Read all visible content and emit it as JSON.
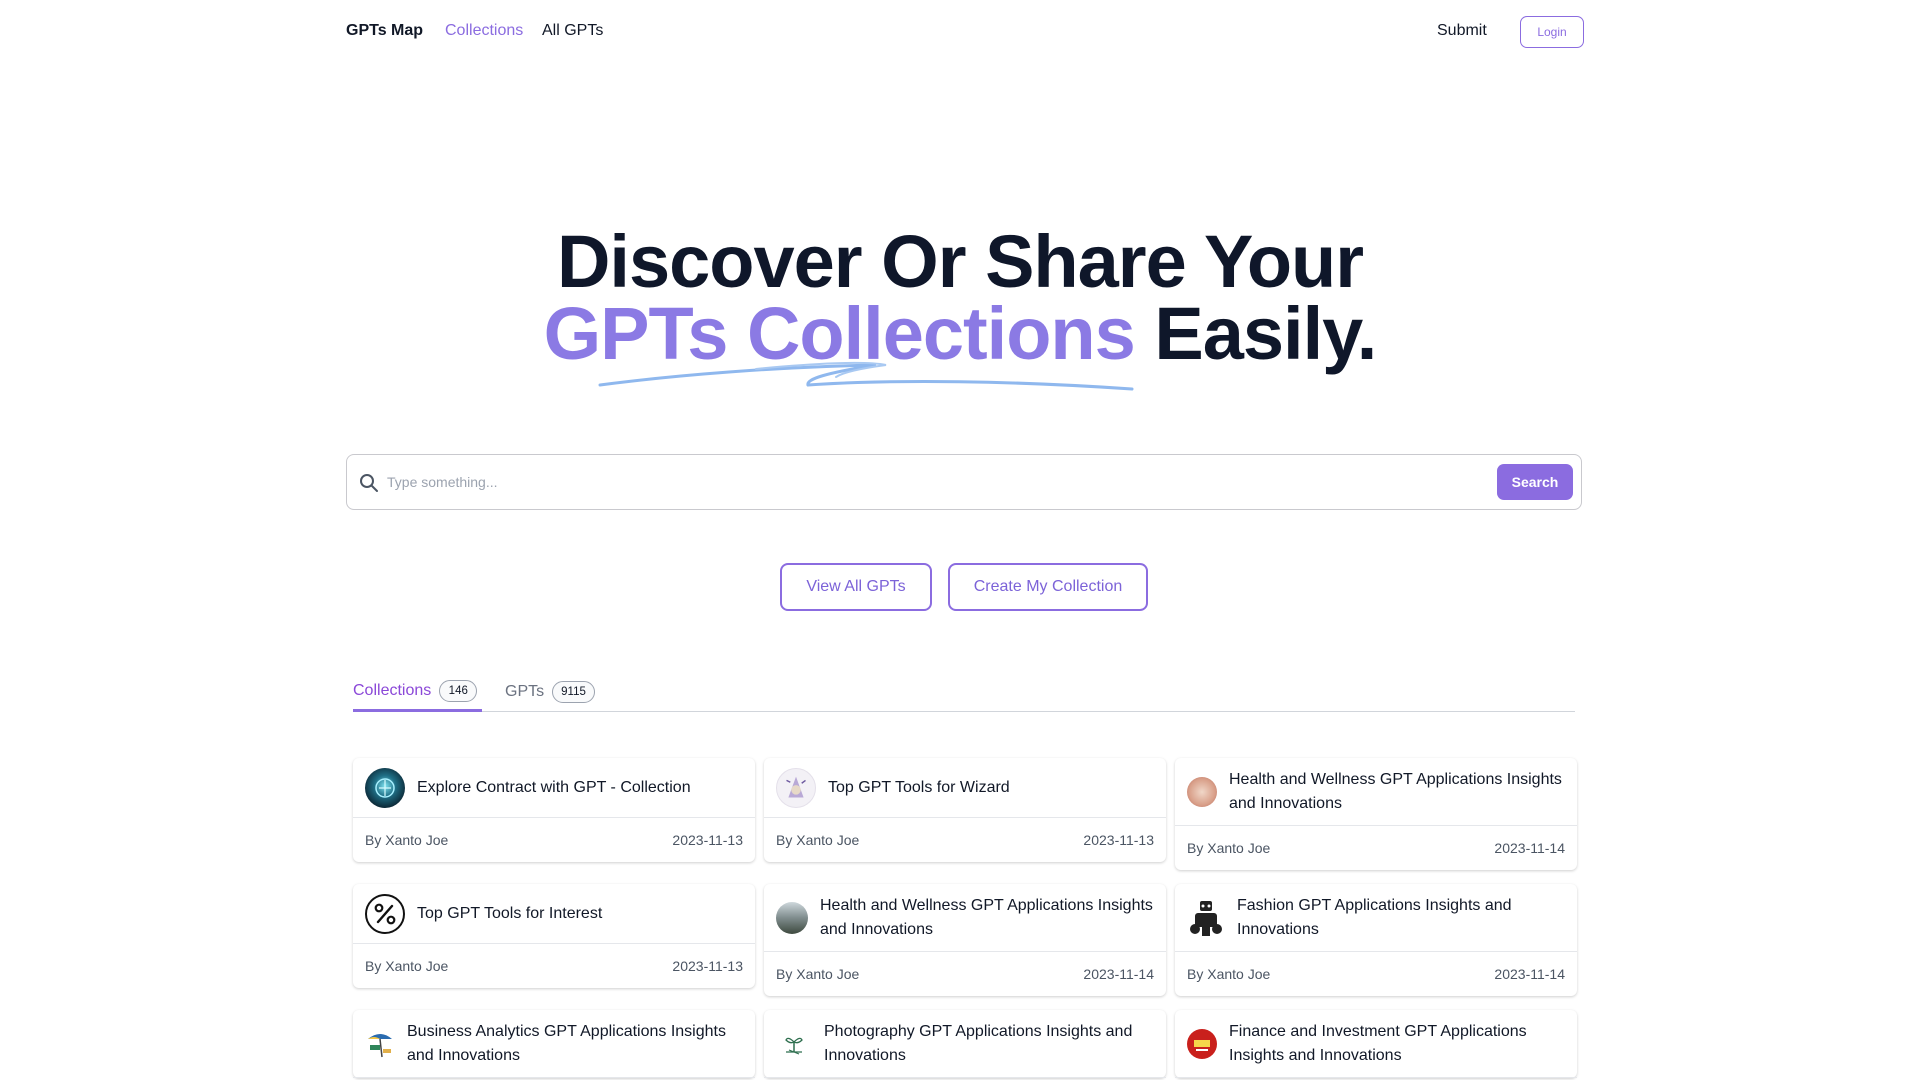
{
  "nav": {
    "brand": "GPTs Map",
    "links": [
      {
        "label": "Collections",
        "active": true
      },
      {
        "label": "All GPTs",
        "active": false
      }
    ],
    "submit_label": "Submit",
    "login_label": "Login"
  },
  "hero": {
    "line1": "Discover Or Share Your",
    "accent": "GPTs Collections",
    "line2_rest": " Easily."
  },
  "search": {
    "placeholder": "Type something...",
    "button_label": "Search"
  },
  "actions": {
    "view_all": "View All GPTs",
    "create": "Create My Collection"
  },
  "tabs": [
    {
      "label": "Collections",
      "count": "146",
      "active": true
    },
    {
      "label": "GPTs",
      "count": "9115",
      "active": false
    }
  ],
  "colors": {
    "accent": "#8b6ce0",
    "heading": "#0f172a"
  },
  "cards": [
    {
      "title": "Explore Contract with GPT - Collection",
      "author": "By Xanto Joe",
      "date": "2023-11-13",
      "icon": "orb-avatar-icon"
    },
    {
      "title": "Top GPT Tools for Wizard",
      "author": "By Xanto Joe",
      "date": "2023-11-13",
      "icon": "wizard-avatar-icon"
    },
    {
      "title": "Health and Wellness GPT Applications Insights and Innovations",
      "author": "By Xanto Joe",
      "date": "2023-11-14",
      "icon": "food-avatar-icon"
    },
    {
      "title": "Top GPT Tools for Interest",
      "author": "By Xanto Joe",
      "date": "2023-11-13",
      "icon": "percent-avatar-icon"
    },
    {
      "title": "Health and Wellness GPT Applications Insights and Innovations",
      "author": "By Xanto Joe",
      "date": "2023-11-14",
      "icon": "landscape-avatar-icon"
    },
    {
      "title": "Fashion GPT Applications Insights and Innovations",
      "author": "By Xanto Joe",
      "date": "2023-11-14",
      "icon": "robot-avatar-icon"
    },
    {
      "title": "Business Analytics GPT Applications Insights and Innovations",
      "author": "",
      "date": "",
      "icon": "beach-avatar-icon"
    },
    {
      "title": "Photography GPT Applications Insights and Innovations",
      "author": "",
      "date": "",
      "icon": "sprout-avatar-icon"
    },
    {
      "title": "Finance and Investment GPT Applications Insights and Innovations",
      "author": "",
      "date": "",
      "icon": "badge-avatar-icon"
    }
  ]
}
